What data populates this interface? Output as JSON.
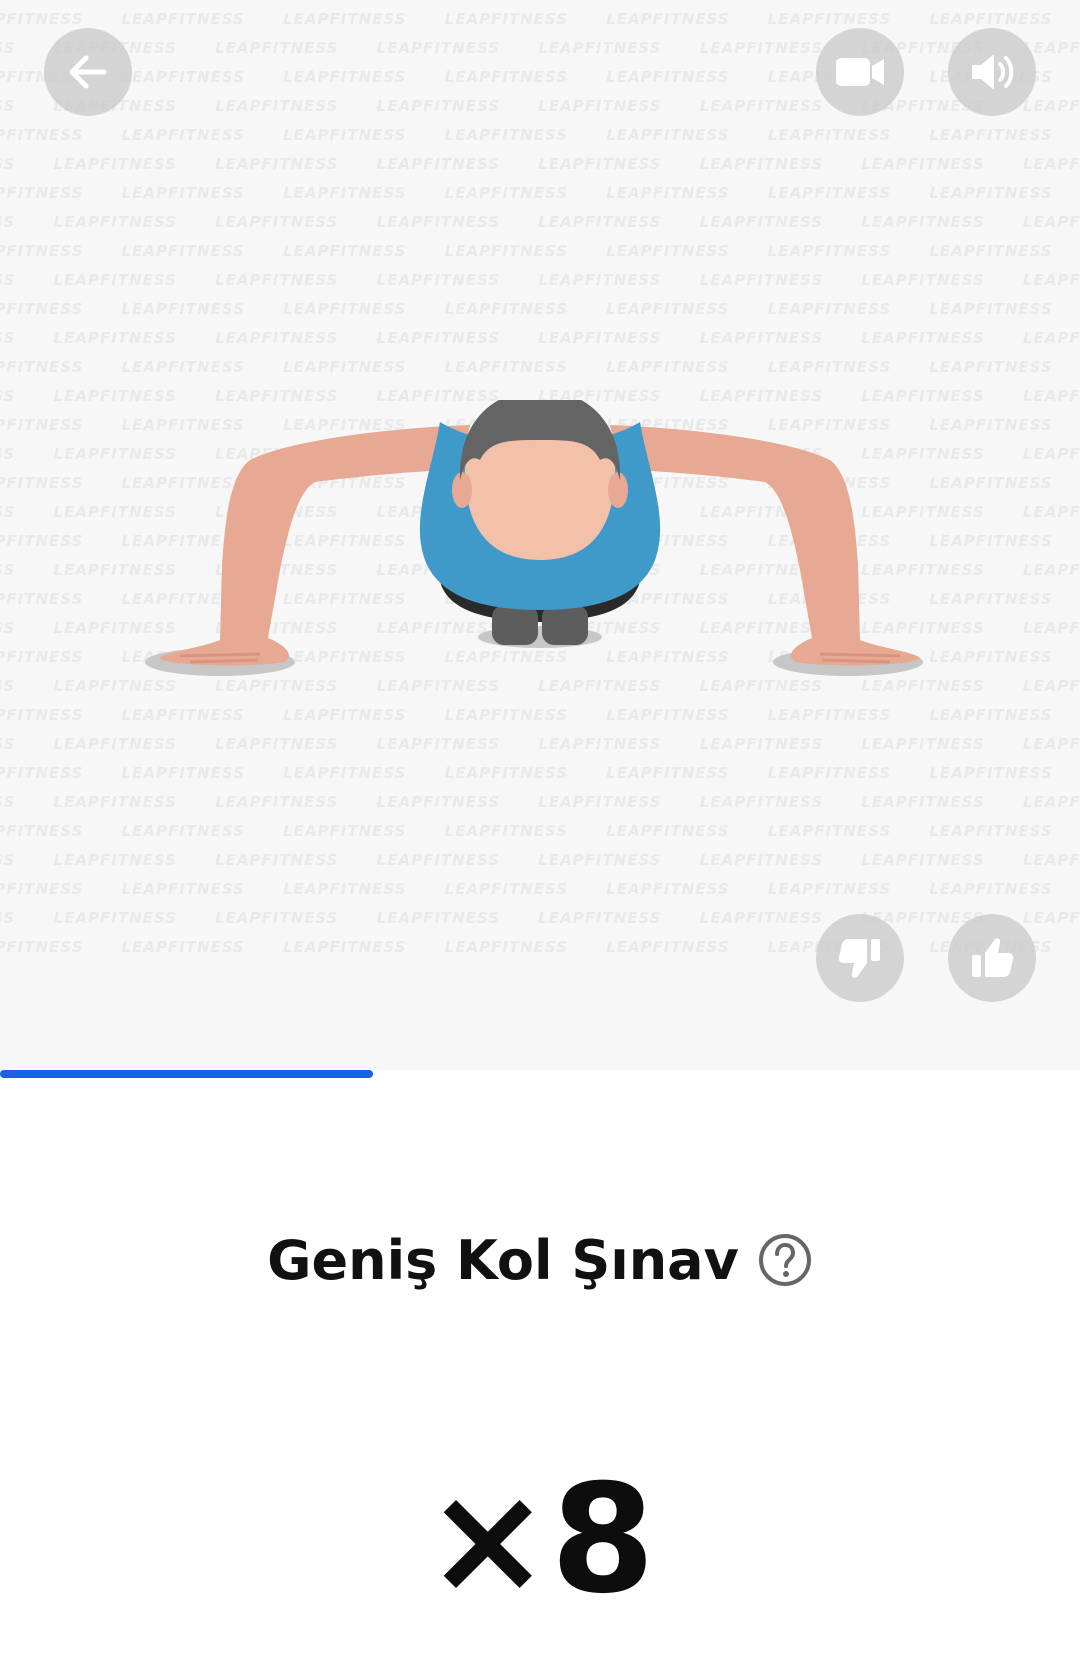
{
  "exercise": {
    "title": "Geniş Kol Şınav",
    "reps": "×8",
    "progress": 0.345
  },
  "watermark_text": "LEAPFITNESS",
  "controls": {
    "back_icon": "arrow-left-icon",
    "video_icon": "video-camera-icon",
    "sound_icon": "speaker-icon",
    "dislike_icon": "thumbs-down-icon",
    "like_icon": "thumbs-up-icon",
    "help_icon": "question-circle-icon"
  },
  "colors": {
    "progress": "#1a5fe8",
    "shirt": "#3f9ac9",
    "skin": "#e8a994",
    "hair": "#646464"
  }
}
